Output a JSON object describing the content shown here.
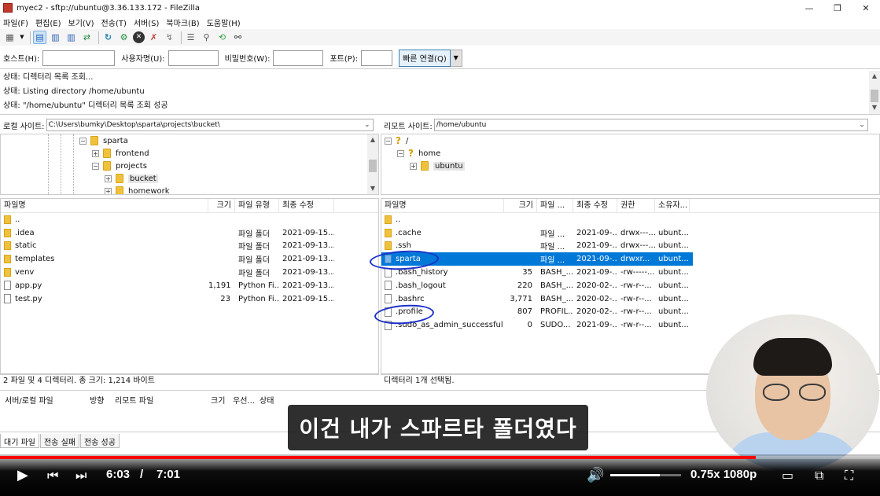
{
  "window": {
    "title": "myec2 - sftp://ubuntu@3.36.133.172 - FileZilla",
    "minimize": "—",
    "maximize": "❐",
    "close": "✕"
  },
  "menu": [
    "파일(F)",
    "편집(E)",
    "보기(V)",
    "전송(T)",
    "서버(S)",
    "북마크(B)",
    "도움말(H)"
  ],
  "toolbar": {
    "icons": [
      "site-manager-icon",
      "dropdown-icon",
      "toggle-log-icon",
      "toggle-local-tree-icon",
      "toggle-remote-tree-icon",
      "toggle-queue-icon",
      "refresh-icon",
      "process-queue-icon",
      "cancel-icon",
      "disconnect-icon",
      "reconnect-icon",
      "filter-icon",
      "compare-icon",
      "sync-browse-icon",
      "search-icon"
    ]
  },
  "connect": {
    "host_label": "호스트(H):",
    "user_label": "사용자명(U):",
    "pass_label": "비밀번호(W):",
    "port_label": "포트(P):",
    "host_value": "",
    "user_value": "",
    "pass_value": "",
    "port_value": "",
    "quick_label": "빠른 연결(Q)"
  },
  "log": [
    "상태:  디렉터리 목록 조회...",
    "상태:  Listing directory /home/ubuntu",
    "상태:  \"/home/ubuntu\" 디렉터리 목록 조회 성공"
  ],
  "local": {
    "site_label": "로컬 사이트:",
    "path": "C:\\Users\\bumky\\Desktop\\sparta\\projects\\bucket\\",
    "tree": [
      "sparta",
      "frontend",
      "projects",
      "bucket",
      "homework"
    ],
    "columns": [
      "파일명",
      "크기",
      "파일 유형",
      "최종 수정"
    ],
    "files": [
      {
        "name": "..",
        "size": "",
        "type": "",
        "modified": "",
        "kind": "folder"
      },
      {
        "name": ".idea",
        "size": "",
        "type": "파일 폴더",
        "modified": "2021-09-15...",
        "kind": "folder"
      },
      {
        "name": "static",
        "size": "",
        "type": "파일 폴더",
        "modified": "2021-09-13...",
        "kind": "folder"
      },
      {
        "name": "templates",
        "size": "",
        "type": "파일 폴더",
        "modified": "2021-09-13...",
        "kind": "folder"
      },
      {
        "name": "venv",
        "size": "",
        "type": "파일 폴더",
        "modified": "2021-09-13...",
        "kind": "folder"
      },
      {
        "name": "app.py",
        "size": "1,191",
        "type": "Python Fi...",
        "modified": "2021-09-13...",
        "kind": "file"
      },
      {
        "name": "test.py",
        "size": "23",
        "type": "Python Fi...",
        "modified": "2021-09-15...",
        "kind": "file"
      }
    ],
    "status": "2 파일 및 4 디렉터리. 총 크기: 1,214 바이트"
  },
  "remote": {
    "site_label": "리모트 사이트:",
    "path": "/home/ubuntu",
    "tree": [
      "/",
      "home",
      "ubuntu"
    ],
    "columns": [
      "파일명",
      "크기",
      "파일 ...",
      "최종 수정",
      "권한",
      "소유자..."
    ],
    "files": [
      {
        "name": "..",
        "size": "",
        "type": "",
        "modified": "",
        "perm": "",
        "owner": "",
        "kind": "folder"
      },
      {
        "name": ".cache",
        "size": "",
        "type": "파일 ...",
        "modified": "2021-09-...",
        "perm": "drwx---...",
        "owner": "ubunt...",
        "kind": "folder"
      },
      {
        "name": ".ssh",
        "size": "",
        "type": "파일 ...",
        "modified": "2021-09-...",
        "perm": "drwx---...",
        "owner": "ubunt...",
        "kind": "folder"
      },
      {
        "name": "sparta",
        "size": "",
        "type": "파일 ...",
        "modified": "2021-09-...",
        "perm": "drwxr...",
        "owner": "ubunt...",
        "kind": "folder",
        "selected": true
      },
      {
        "name": ".bash_history",
        "size": "35",
        "type": "BASH_...",
        "modified": "2021-09-...",
        "perm": "-rw-----...",
        "owner": "ubunt...",
        "kind": "file"
      },
      {
        "name": ".bash_logout",
        "size": "220",
        "type": "BASH_...",
        "modified": "2020-02-...",
        "perm": "-rw-r--...",
        "owner": "ubunt...",
        "kind": "file"
      },
      {
        "name": ".bashrc",
        "size": "3,771",
        "type": "BASH_...",
        "modified": "2020-02-...",
        "perm": "-rw-r--...",
        "owner": "ubunt...",
        "kind": "file"
      },
      {
        "name": ".profile",
        "size": "807",
        "type": "PROFIL...",
        "modified": "2020-02-...",
        "perm": "-rw-r--...",
        "owner": "ubunt...",
        "kind": "file"
      },
      {
        "name": ".sudo_as_admin_successful",
        "size": "0",
        "type": "SUDO...",
        "modified": "2021-09-...",
        "perm": "-rw-r--...",
        "owner": "ubunt...",
        "kind": "file"
      }
    ],
    "status": "디렉터리 1개 선택됨."
  },
  "queue": {
    "columns": [
      "서버/로컬 파일",
      "방향",
      "리모트 파일",
      "크기",
      "우선...",
      "상태"
    ],
    "tabs": [
      "대기 파일",
      "전송 실패",
      "전송 성공"
    ]
  },
  "video": {
    "subtitle": "이건 내가 스파르타 폴더였다",
    "current_time": "6:03",
    "separator": "/",
    "duration": "7:01",
    "progress": 0.859,
    "volume": 0.7,
    "speed_quality": "0.75x 1080p"
  }
}
